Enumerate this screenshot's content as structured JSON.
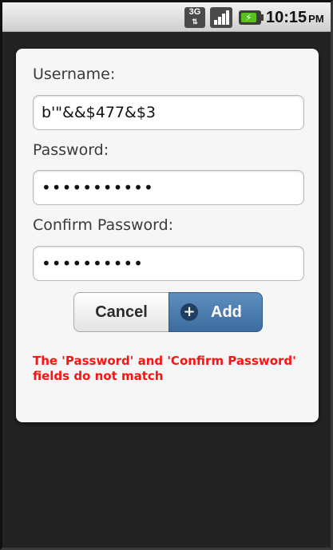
{
  "status_bar": {
    "network": "3G",
    "time": "10:15",
    "ampm": "PM",
    "icons": [
      "3g-icon",
      "signal-icon",
      "battery-charging-icon"
    ]
  },
  "form": {
    "username_label": "Username:",
    "username_value": "b'\"&&$477&$3",
    "password_label": "Password:",
    "password_value": "•••••••••••",
    "confirm_label": "Confirm Password:",
    "confirm_value": "••••••••••"
  },
  "buttons": {
    "cancel_label": "Cancel",
    "add_label": "Add"
  },
  "error_message": "The 'Password' and 'Confirm Password' fields do not match",
  "colors": {
    "error": "#ff1111",
    "accent": "#4a7aab",
    "dialog_bg": "#f6f6f6"
  }
}
